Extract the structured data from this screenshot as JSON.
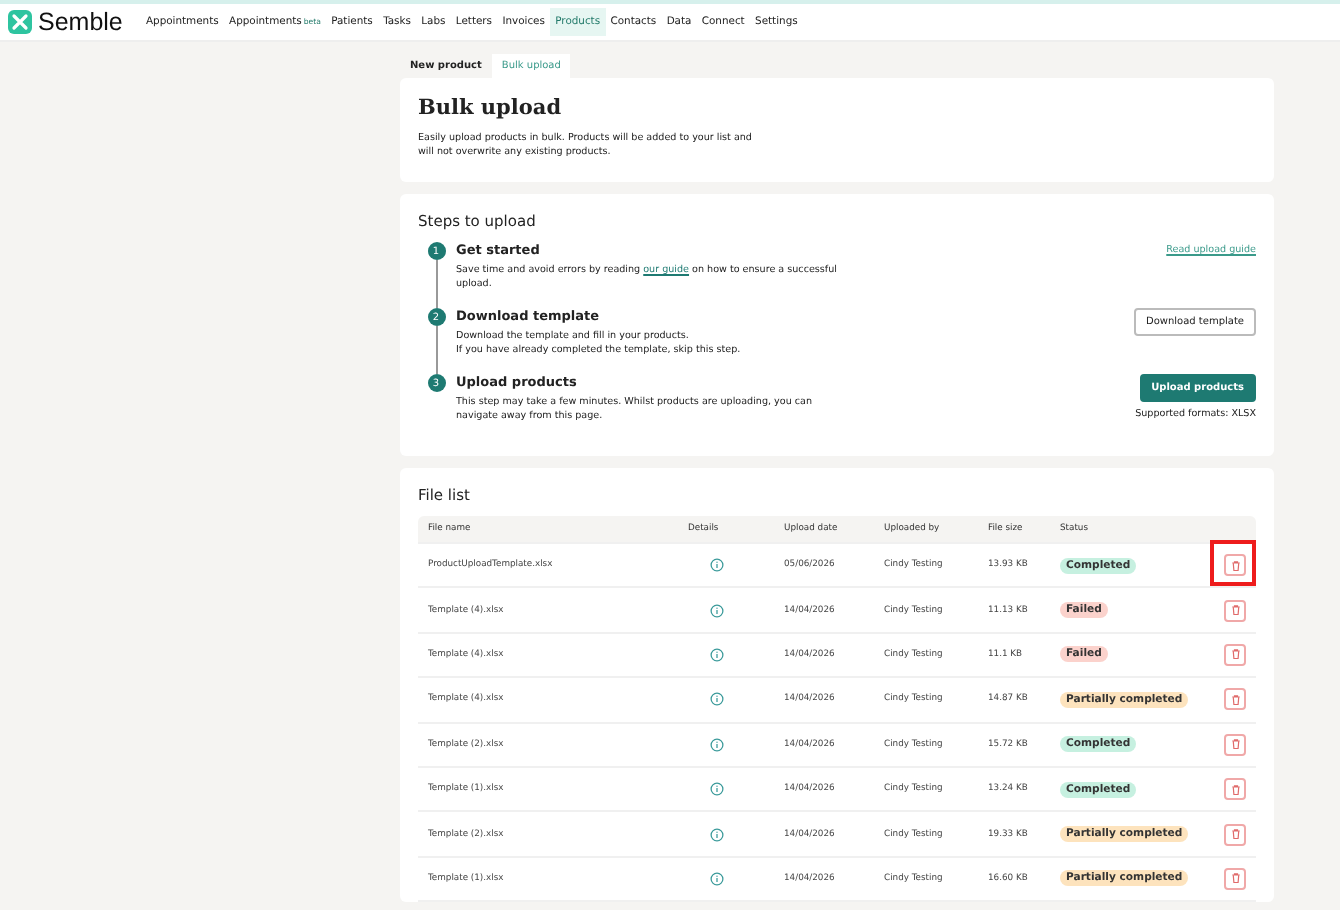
{
  "brand": {
    "name": "Semble"
  },
  "nav": [
    {
      "label": "Appointments",
      "selected": false
    },
    {
      "label": "Appointments",
      "badge": "beta",
      "selected": false
    },
    {
      "label": "Patients",
      "selected": false
    },
    {
      "label": "Tasks",
      "selected": false
    },
    {
      "label": "Labs",
      "selected": false
    },
    {
      "label": "Letters",
      "selected": false
    },
    {
      "label": "Invoices",
      "selected": false
    },
    {
      "label": "Products",
      "selected": true
    },
    {
      "label": "Contacts",
      "selected": false
    },
    {
      "label": "Data",
      "selected": false
    },
    {
      "label": "Connect",
      "selected": false
    },
    {
      "label": "Settings",
      "selected": false
    }
  ],
  "tabs": [
    {
      "label": "New product",
      "selected": false
    },
    {
      "label": "Bulk upload",
      "selected": true
    }
  ],
  "header": {
    "title": "Bulk upload",
    "description": "Easily upload products in bulk. Products will be added to your list and will not overwrite any existing products."
  },
  "steps_card": {
    "title": "Steps to upload",
    "steps": [
      {
        "number": "1",
        "kind": "link",
        "title": "Get started",
        "text": "Save time and avoid errors by reading ",
        "link": "our guide",
        "text_after": " on how to ensure a successful upload.",
        "action": "Read upload guide"
      },
      {
        "number": "2",
        "kind": "secondary",
        "title": "Download template",
        "text": "Download the template and fill in your products.\nIf you have already completed the template, skip this step.",
        "action": "Download template"
      },
      {
        "number": "3",
        "kind": "primary",
        "title": "Upload products",
        "text": "This step may take a few minutes. Whilst products are uploading, you can navigate away from this page.",
        "action": "Upload products",
        "note": "Supported formats: XLSX"
      }
    ]
  },
  "file_list": {
    "title": "File list",
    "columns": [
      "File name",
      "Details",
      "Upload date",
      "Uploaded by",
      "File size",
      "Status"
    ],
    "rows": [
      {
        "file": "ProductUploadTemplate.xlsx",
        "date": "05/06/2026",
        "by": "Cindy Testing",
        "size": "13.93 KB",
        "status": "Completed",
        "kind": "completed",
        "highlighted": true
      },
      {
        "file": "Template (4).xlsx",
        "date": "14/04/2026",
        "by": "Cindy Testing",
        "size": "11.13 KB",
        "status": "Failed",
        "kind": "failed",
        "highlighted": false
      },
      {
        "file": "Template (4).xlsx",
        "date": "14/04/2026",
        "by": "Cindy Testing",
        "size": "11.1 KB",
        "status": "Failed",
        "kind": "failed",
        "highlighted": false
      },
      {
        "file": "Template (4).xlsx",
        "date": "14/04/2026",
        "by": "Cindy Testing",
        "size": "14.87 KB",
        "status": "Partially completed",
        "kind": "partial",
        "highlighted": false
      },
      {
        "file": "Template (2).xlsx",
        "date": "14/04/2026",
        "by": "Cindy Testing",
        "size": "15.72 KB",
        "status": "Completed",
        "kind": "completed",
        "highlighted": false
      },
      {
        "file": "Template (1).xlsx",
        "date": "14/04/2026",
        "by": "Cindy Testing",
        "size": "13.24 KB",
        "status": "Completed",
        "kind": "completed",
        "highlighted": false
      },
      {
        "file": "Template (2).xlsx",
        "date": "14/04/2026",
        "by": "Cindy Testing",
        "size": "19.33 KB",
        "status": "Partially completed",
        "kind": "partial",
        "highlighted": false
      },
      {
        "file": "Template (1).xlsx",
        "date": "14/04/2026",
        "by": "Cindy Testing",
        "size": "16.60 KB",
        "status": "Partially completed",
        "kind": "partial",
        "highlighted": false
      }
    ]
  }
}
